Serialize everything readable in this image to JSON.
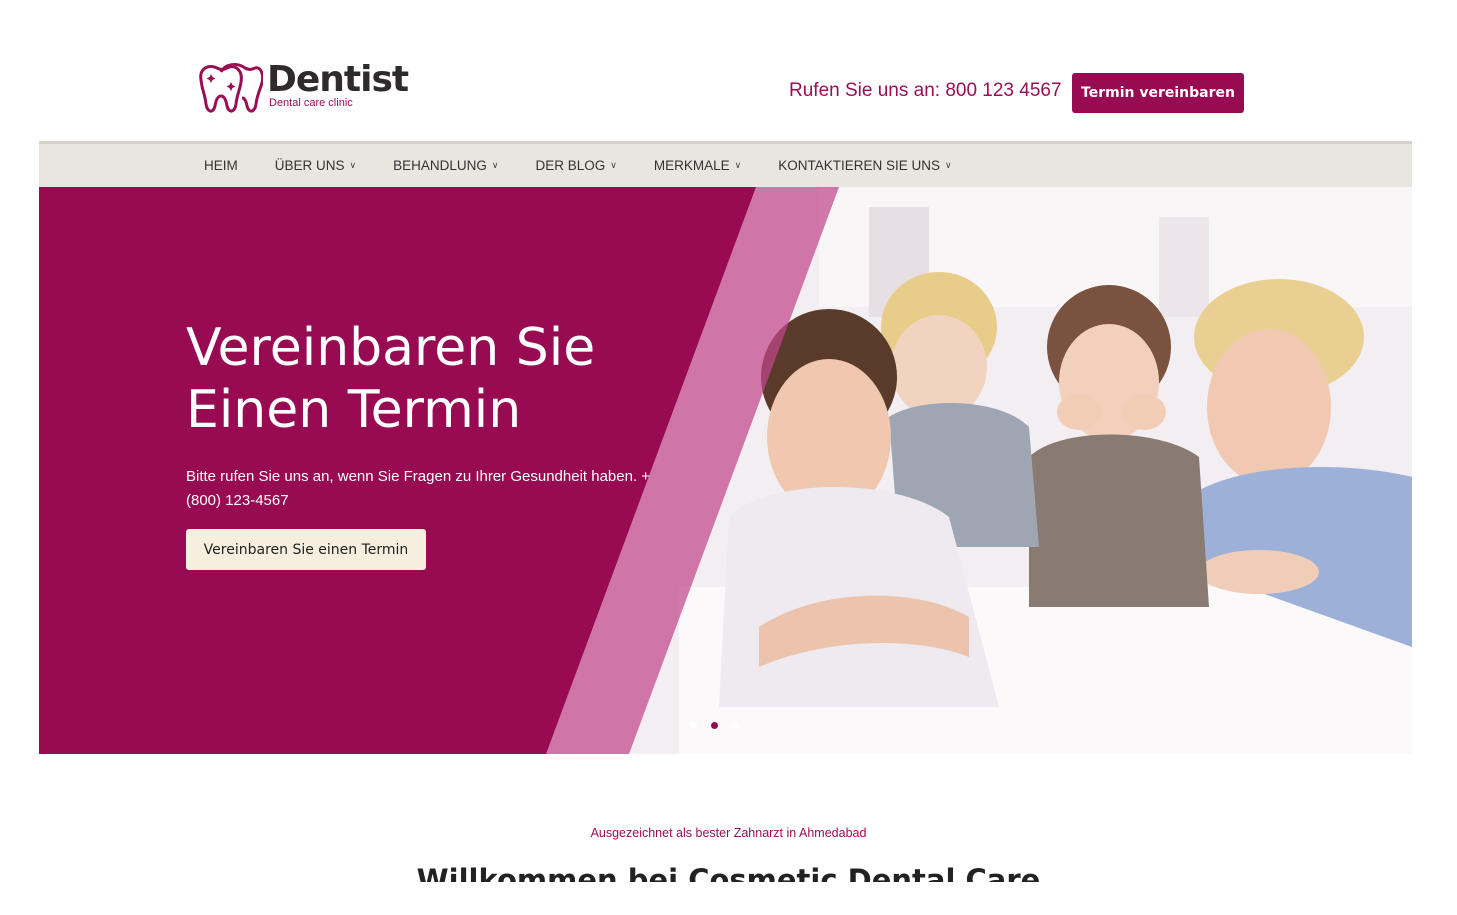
{
  "brand": {
    "name": "Dentist",
    "tagline": "Dental care clinic",
    "color": "#980b52"
  },
  "header": {
    "phone_text": "Rufen Sie uns an: 800 123 4567",
    "cta_label": "Termin vereinbaren"
  },
  "nav": {
    "items": [
      {
        "label": "HEIM",
        "dropdown": false
      },
      {
        "label": "ÜBER UNS",
        "dropdown": true
      },
      {
        "label": "BEHANDLUNG",
        "dropdown": true
      },
      {
        "label": "DER BLOG",
        "dropdown": true
      },
      {
        "label": "MERKMALE",
        "dropdown": true
      },
      {
        "label": "KONTAKTIEREN SIE UNS",
        "dropdown": true
      }
    ],
    "chevron_icon": "chevron-down-icon"
  },
  "hero": {
    "title": "Vereinbaren Sie Einen Termin",
    "text": "Bitte rufen Sie uns an, wenn Sie Fragen zu Ihrer Gesundheit haben. +(800) 123-4567",
    "button_label": "Vereinbaren Sie einen Termin",
    "slide_count": 3,
    "active_slide": 2,
    "image_subject": "family-photo"
  },
  "intro": {
    "kicker": "Ausgezeichnet als bester Zahnarzt in Ahmedabad",
    "title": "Willkommen bei Cosmetic Dental Care"
  }
}
